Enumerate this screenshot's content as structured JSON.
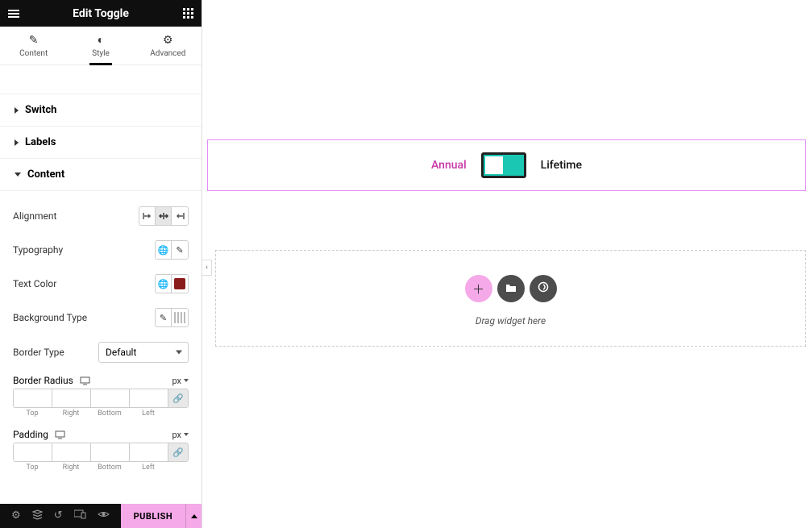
{
  "header": {
    "title": "Edit Toggle"
  },
  "tabs": {
    "content": "Content",
    "style": "Style",
    "advanced": "Advanced",
    "active": "style"
  },
  "sections": {
    "switch": "Switch",
    "labels": "Labels",
    "content": "Content"
  },
  "controls": {
    "alignment": {
      "label": "Alignment"
    },
    "typography": {
      "label": "Typography"
    },
    "textColor": {
      "label": "Text Color",
      "value": "#8a1c1c"
    },
    "backgroundType": {
      "label": "Background Type"
    },
    "borderType": {
      "label": "Border Type",
      "value": "Default"
    },
    "borderRadius": {
      "label": "Border Radius",
      "unit": "px"
    },
    "padding": {
      "label": "Padding",
      "unit": "px"
    },
    "sides": {
      "top": "Top",
      "right": "Right",
      "bottom": "Bottom",
      "left": "Left"
    }
  },
  "footer": {
    "publish": "PUBLISH"
  },
  "preview": {
    "toggle": {
      "left": "Annual",
      "right": "Lifetime"
    },
    "drop": {
      "text": "Drag widget here"
    }
  }
}
